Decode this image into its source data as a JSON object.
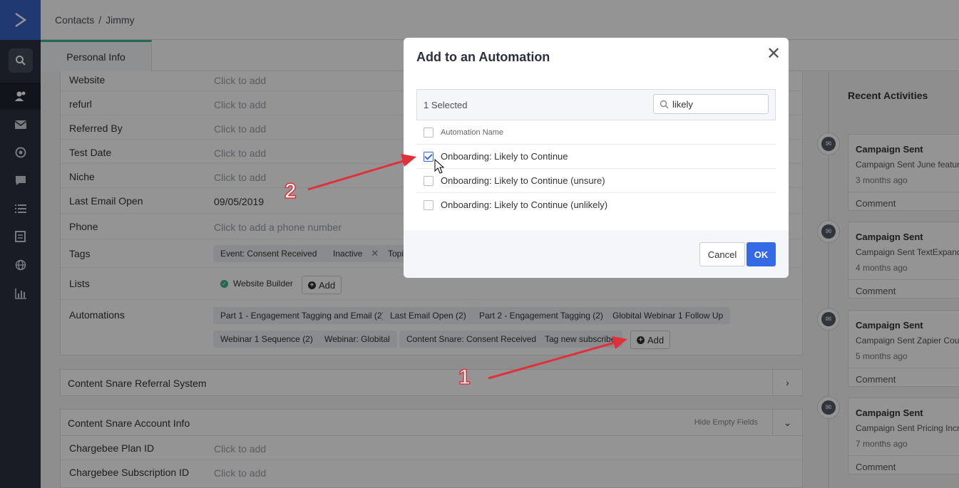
{
  "header": {
    "breadcrumb": [
      "Contacts",
      "Jimmy"
    ],
    "breadcrumb_sep": "/"
  },
  "tabs": [
    {
      "label": "Personal Info",
      "active": true
    }
  ],
  "sidebar": {
    "items": [
      "logo-icon",
      "search-icon",
      "contacts-icon",
      "mail-icon",
      "automations-icon",
      "conversations-icon",
      "lists-icon",
      "forms-icon",
      "site-icon",
      "reports-icon"
    ],
    "active": "contacts-icon"
  },
  "fields": [
    {
      "label": "Website",
      "value": "Click to add",
      "placeholder": true
    },
    {
      "label": "refurl",
      "value": "Click to add",
      "placeholder": true
    },
    {
      "label": "Referred By",
      "value": "Click to add",
      "placeholder": true
    },
    {
      "label": "Test Date",
      "value": "Click to add",
      "placeholder": true
    },
    {
      "label": "Niche",
      "value": "Click to add",
      "placeholder": true
    },
    {
      "label": "Last Email Open",
      "value": "09/05/2019",
      "placeholder": false
    },
    {
      "label": "Phone",
      "value": "Click to add a phone number",
      "placeholder": true
    },
    {
      "label": "Tags",
      "value": "",
      "placeholder": false
    },
    {
      "label": "Lists",
      "value": "",
      "placeholder": false
    },
    {
      "label": "Automations",
      "value": "",
      "placeholder": false
    }
  ],
  "tags": [
    "Event: Consent Received",
    "Inactive",
    "Topic"
  ],
  "lists": {
    "items": [
      "Website Builder"
    ],
    "add_label": "Add"
  },
  "automations": {
    "items": [
      "Part 1 - Engagement Tagging and Email (2)",
      "Last Email Open (2)",
      "Part 2 - Engagement Tagging (2)",
      "Globital Webinar 1 Follow Up",
      "Webinar 1 Sequence (2)",
      "Webinar: Globital",
      "Content Snare: Consent Received",
      "Tag new subscribe"
    ],
    "add_label": "Add"
  },
  "sections": [
    {
      "title": "Content Snare Referral System",
      "chevron": "chevron-right-icon"
    },
    {
      "title": "Content Snare Account Info",
      "action": "Hide Empty Fields",
      "chevron": "chevron-down-icon"
    }
  ],
  "account_fields": [
    {
      "label": "Chargebee Plan ID",
      "value": "Click to add"
    },
    {
      "label": "Chargebee Subscription ID",
      "value": "Click to add"
    }
  ],
  "recent": {
    "title": "Recent Activities",
    "items": [
      {
        "title": "Campaign Sent",
        "desc": "Campaign Sent June feature",
        "when": "3 months ago",
        "comment": "Comment"
      },
      {
        "title": "Campaign Sent",
        "desc": "Campaign Sent TextExpande",
        "when": "4 months ago",
        "comment": "Comment"
      },
      {
        "title": "Campaign Sent",
        "desc": "Campaign Sent Zapier Cours",
        "when": "5 months ago",
        "comment": "Comment"
      },
      {
        "title": "Campaign Sent",
        "desc": "Campaign Sent Pricing Incre",
        "when": "7 months ago",
        "comment": "Comment"
      }
    ]
  },
  "modal": {
    "title": "Add to an Automation",
    "selected_text": "1 Selected",
    "search_value": "likely",
    "column_header": "Automation Name",
    "rows": [
      {
        "label": "Onboarding: Likely to Continue",
        "checked": true
      },
      {
        "label": "Onboarding: Likely to Continue (unsure)",
        "checked": false
      },
      {
        "label": "Onboarding: Likely to Continue (unlikely)",
        "checked": false
      }
    ],
    "cancel_label": "Cancel",
    "ok_label": "OK",
    "accent": "#356ae6"
  },
  "annotations": [
    "1",
    "2"
  ],
  "colors": {
    "sidebar": "#2c3140",
    "logo": "#3a63c4",
    "tab_accent": "#3db38a",
    "arrow": "#e0303a"
  }
}
